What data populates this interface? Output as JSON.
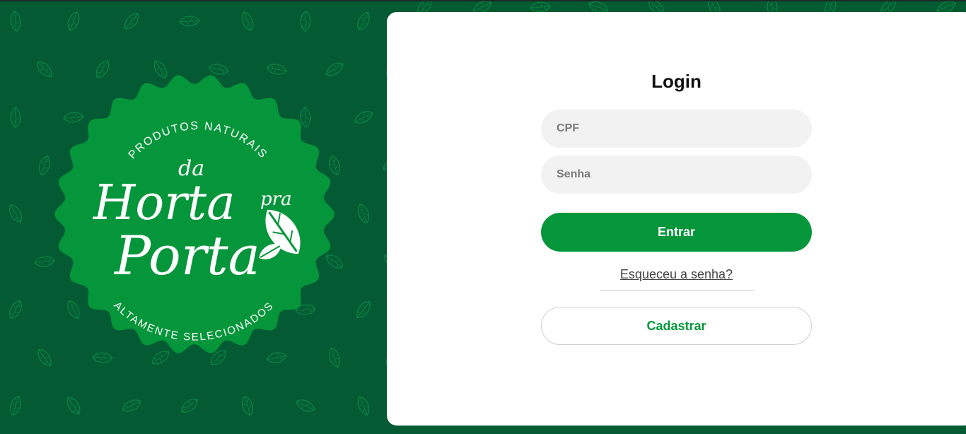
{
  "brand": {
    "top_text": "PRODUTOS NATURAIS",
    "bottom_text": "ALTAMENTE SELECIONADOS",
    "logo_words": [
      "da",
      "Horta",
      "pra",
      "Porta"
    ],
    "colors": {
      "background": "#035a33",
      "badge": "#05963b",
      "leaf_pattern": "#0a7a3f"
    }
  },
  "login": {
    "title": "Login",
    "cpf_placeholder": "CPF",
    "password_placeholder": "Senha",
    "submit_label": "Entrar",
    "forgot_label": "Esqueceu a senha?",
    "register_label": "Cadastrar",
    "accent_color": "#05963b"
  }
}
